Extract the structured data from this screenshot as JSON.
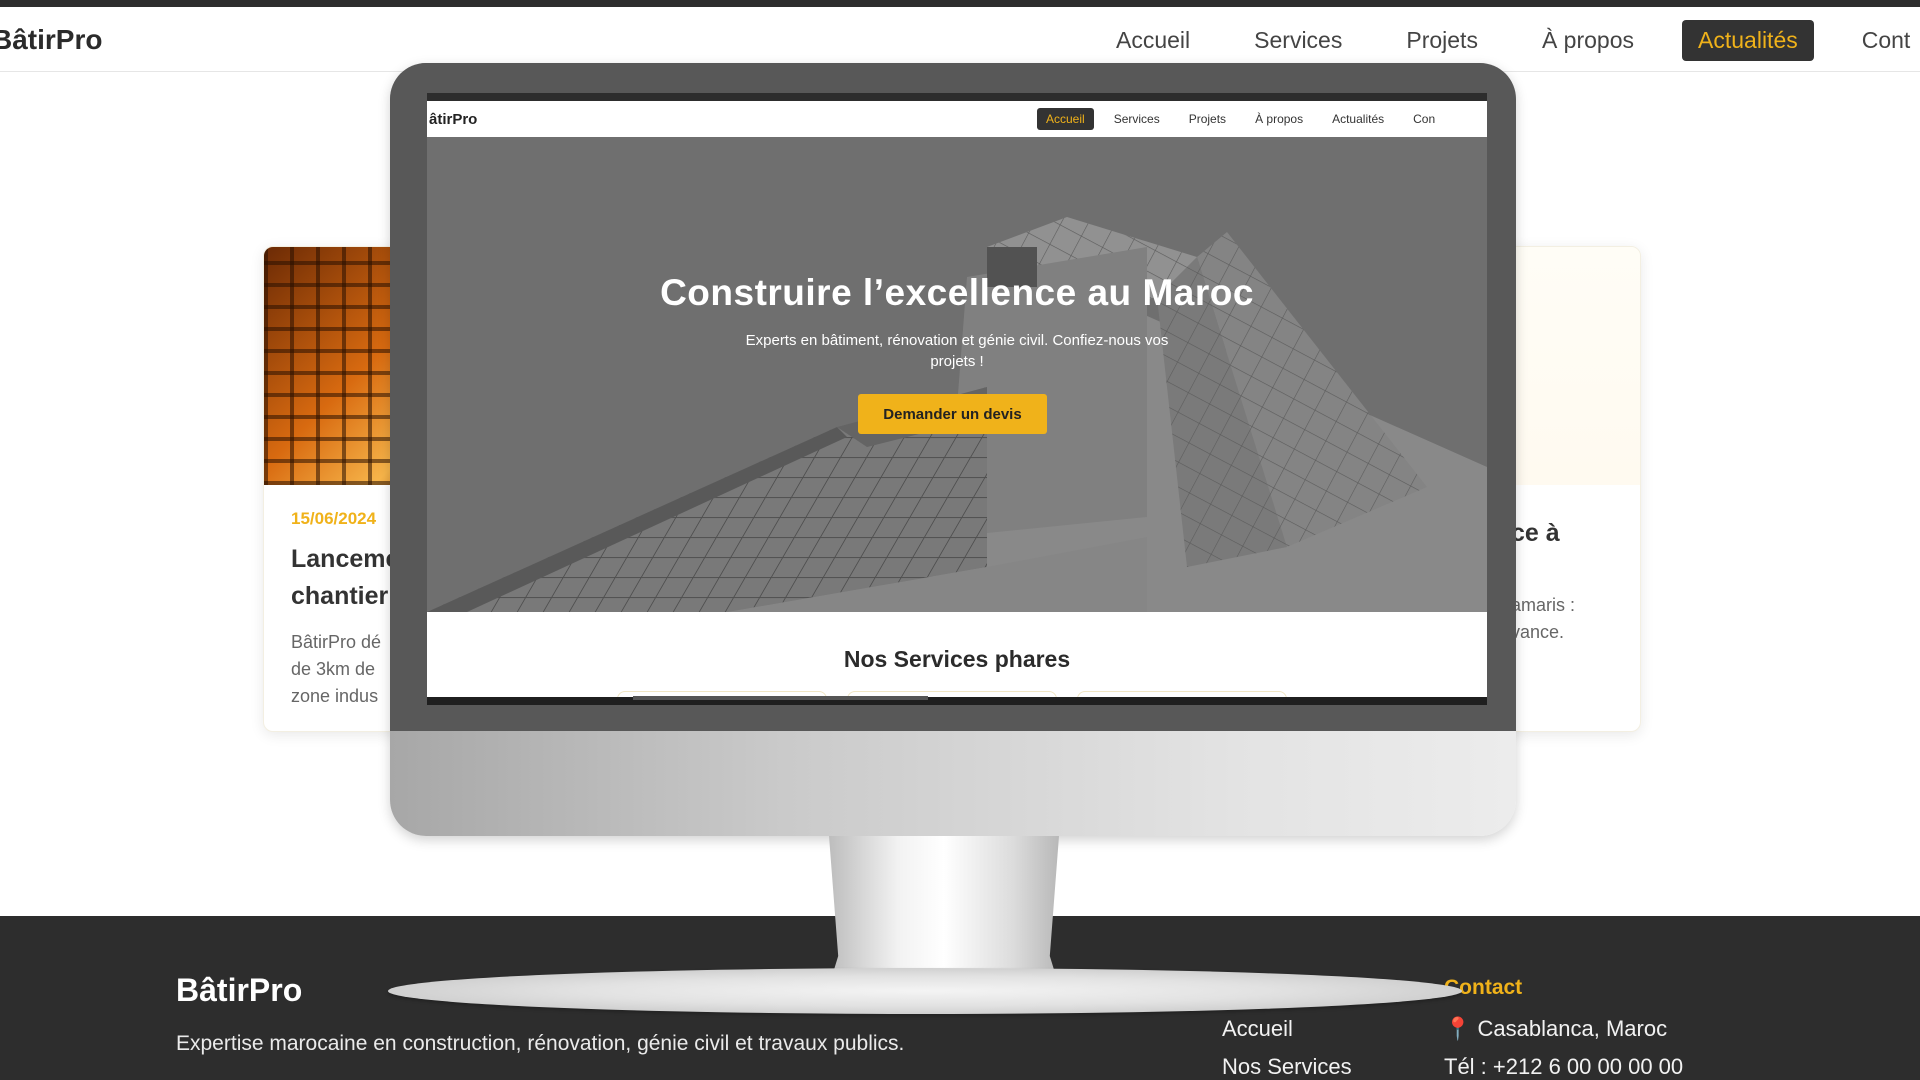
{
  "background_page": {
    "logo": "BâtirPro",
    "nav": [
      {
        "label": "Accueil",
        "active": false
      },
      {
        "label": "Services",
        "active": false
      },
      {
        "label": "Projets",
        "active": false
      },
      {
        "label": "À propos",
        "active": false
      },
      {
        "label": "Actualités",
        "active": true
      },
      {
        "label": "Cont",
        "active": false
      }
    ],
    "cards": [
      {
        "date": "15/06/2024",
        "title_line1": "Lanceme",
        "title_line2": "chantier",
        "text_lines": [
          "BâtirPro dé",
          "de 3km de",
          "zone indus"
        ]
      },
      {
        "title_line1": "ce à",
        "text_lines": [
          "amaris :",
          "vance."
        ]
      }
    ],
    "footer": {
      "logo": "BâtirPro",
      "description": "Expertise marocaine en construction, rénovation, génie civil et travaux publics.",
      "links": [
        "Accueil",
        "Nos Services"
      ],
      "contact_heading": "Contact",
      "contact_address": "Casablanca, Maroc",
      "contact_phone": "Tél : +212 6 00 00 00 00"
    }
  },
  "monitor_screen": {
    "logo": "âtirPro",
    "nav": [
      {
        "label": "Accueil",
        "active": true
      },
      {
        "label": "Services",
        "active": false
      },
      {
        "label": "Projets",
        "active": false
      },
      {
        "label": "À propos",
        "active": false
      },
      {
        "label": "Actualités",
        "active": false
      },
      {
        "label": "Con",
        "active": false
      }
    ],
    "hero": {
      "title": "Construire l’excellence au Maroc",
      "subtitle": "Experts en bâtiment, rénovation et génie civil. Confiez-nous vos projets !",
      "cta": "Demander un devis"
    },
    "services_heading": "Nos Services phares"
  },
  "colors": {
    "accent": "#f0b21a",
    "dark": "#2d2d2d",
    "pin": "#e23b2e"
  },
  "icons": {
    "location": "pin-icon"
  }
}
